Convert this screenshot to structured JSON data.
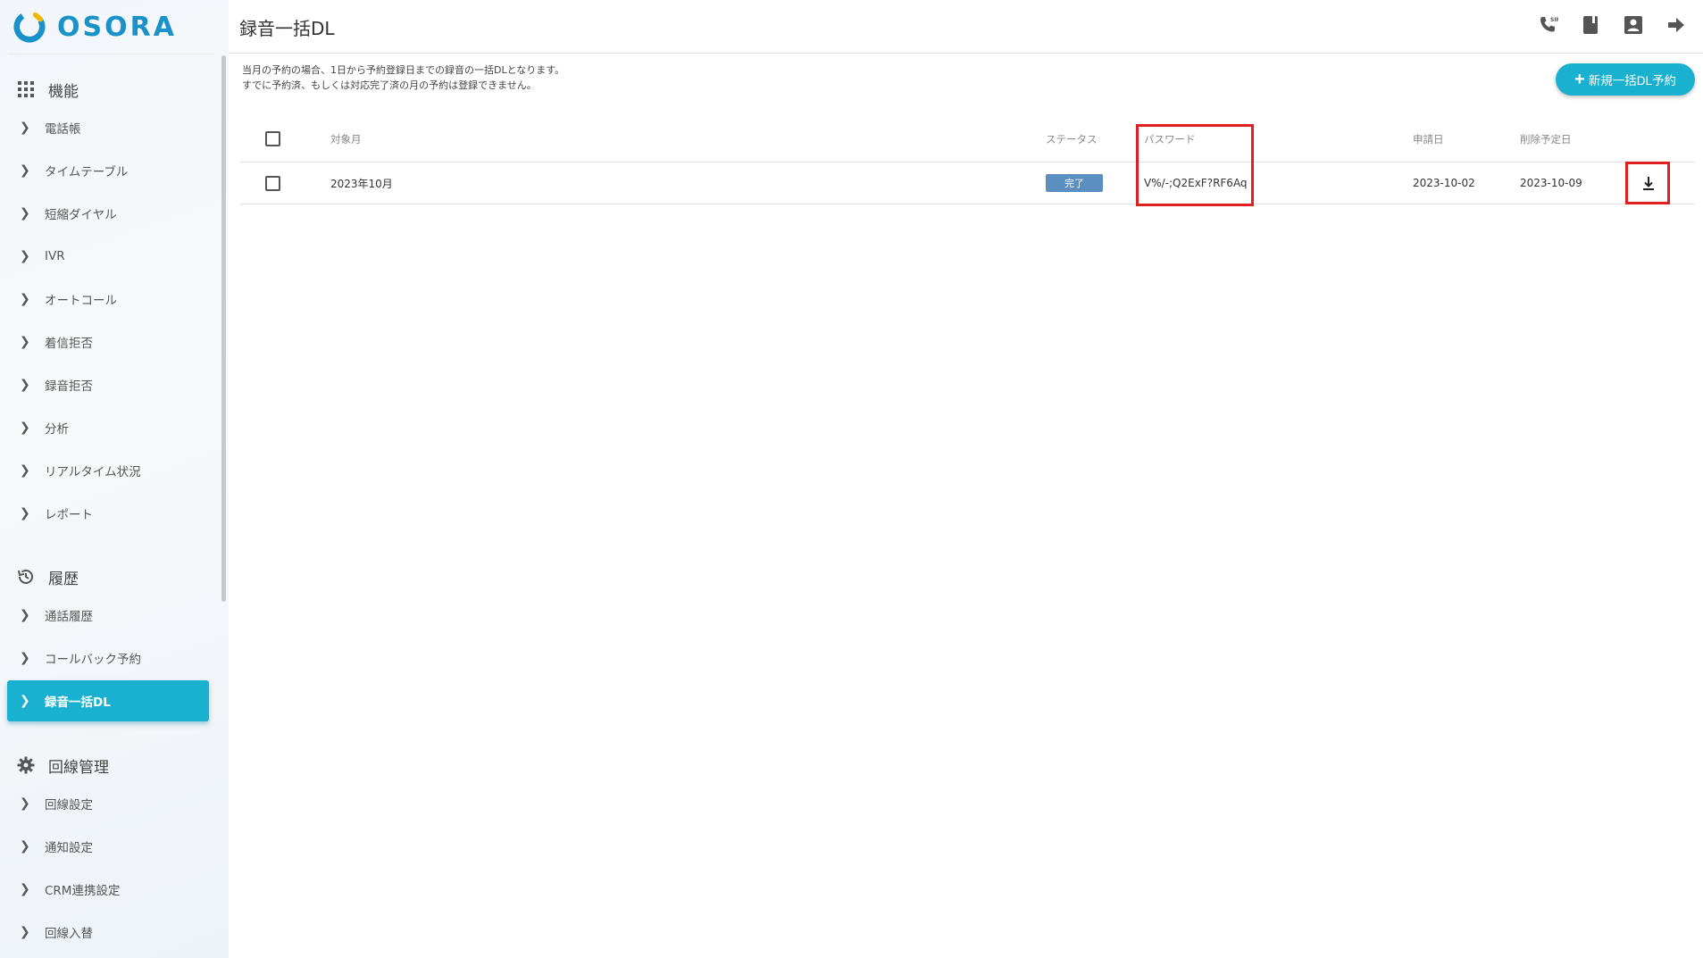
{
  "app": {
    "logo_text": "OSORA",
    "brand_color": "#1b91c9",
    "accent_color": "#1ab0cf"
  },
  "header": {
    "title": "録音一括DL",
    "icons": [
      "sip-phone-icon",
      "phonebook-icon",
      "account-icon",
      "logout-icon"
    ]
  },
  "sidebar": {
    "sections": [
      {
        "label": "機能",
        "icon": "grid-icon",
        "items": [
          "電話帳",
          "タイムテーブル",
          "短縮ダイヤル",
          "IVR",
          "オートコール",
          "着信拒否",
          "録音拒否",
          "分析",
          "リアルタイム状況",
          "レポート"
        ]
      },
      {
        "label": "履歴",
        "icon": "history-icon",
        "items": [
          "通話履歴",
          "コールバック予約",
          "録音一括DL"
        ]
      },
      {
        "label": "回線管理",
        "icon": "gear-icon",
        "items": [
          "回線設定",
          "通知設定",
          "CRM連携設定",
          "回線入替"
        ]
      }
    ],
    "active_item": "録音一括DL"
  },
  "notice": {
    "line1": "当月の予約の場合、1日から予約登録日までの録音の一括DLとなります。",
    "line2": "すでに予約済、もしくは対応完了済の月の予約は登録できません。"
  },
  "new_button": {
    "label": "新規一括DL予約"
  },
  "table": {
    "columns": {
      "target_month": "対象月",
      "status": "ステータス",
      "password": "パスワード",
      "requested": "申請日",
      "deletion": "削除予定日"
    },
    "rows": [
      {
        "target_month": "2023年10月",
        "status": "完了",
        "password": "V%/-;Q2ExF?RF6Aq",
        "requested": "2023-10-02",
        "deletion": "2023-10-09"
      }
    ]
  },
  "highlight_color": "#e02020",
  "status_badge_color": "#5b8fc0"
}
